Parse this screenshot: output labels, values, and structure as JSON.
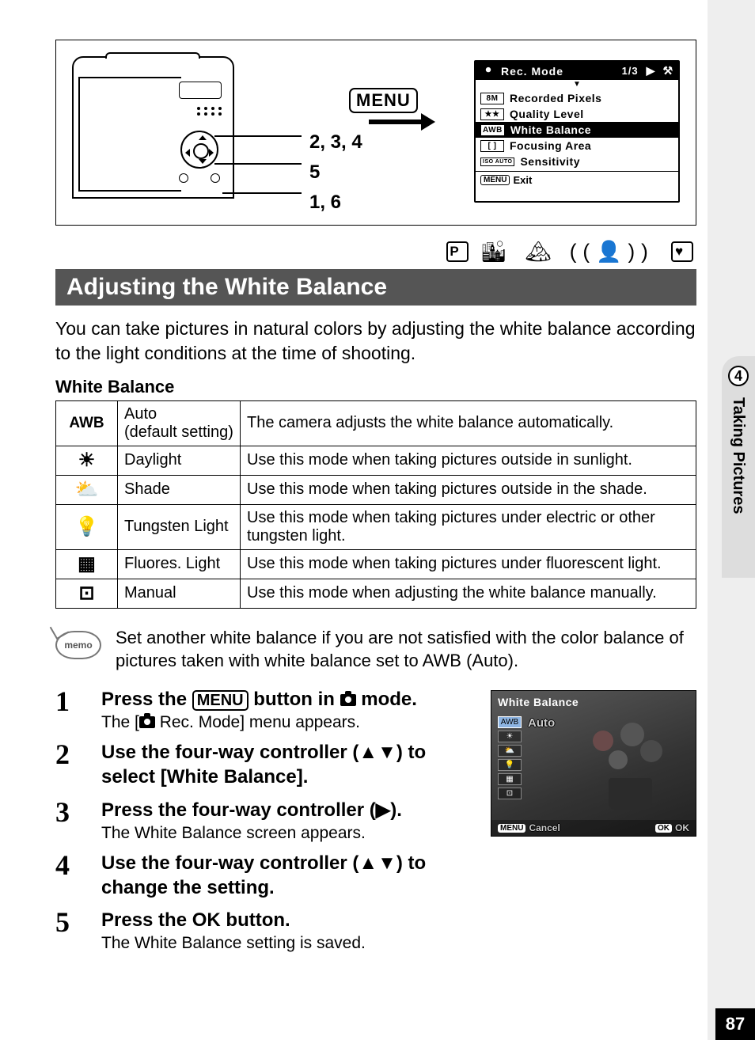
{
  "diagram": {
    "menu_label": "MENU",
    "callouts": [
      "2, 3, 4",
      "5",
      "1, 6"
    ]
  },
  "rec_mode_screen": {
    "title": "Rec. Mode",
    "page_indicator": "1/3",
    "rows": [
      {
        "chip": "8M",
        "label": "Recorded Pixels"
      },
      {
        "chip": "★★",
        "label": "Quality Level"
      },
      {
        "chip": "AWB",
        "label": "White Balance"
      },
      {
        "chip": "[ ]",
        "label": "Focusing Area"
      },
      {
        "chip": "ISO AUTO",
        "label": "Sensitivity"
      }
    ],
    "exit_chip": "MENU",
    "exit_label": "Exit"
  },
  "mode_row": {
    "p": "P"
  },
  "heading": "Adjusting the White Balance",
  "intro": "You can take pictures in natural colors by adjusting the white balance according to the light conditions at the time of shooting.",
  "table_caption": "White Balance",
  "wb_table": [
    {
      "icon": "AWB",
      "name": "Auto\n(default setting)",
      "desc": "The camera adjusts the white balance automatically."
    },
    {
      "icon": "☀",
      "name": "Daylight",
      "desc": "Use this mode when taking pictures outside in sunlight."
    },
    {
      "icon": "⛅",
      "name": "Shade",
      "desc": "Use this mode when taking pictures outside in the shade."
    },
    {
      "icon": "💡",
      "name": "Tungsten Light",
      "desc": "Use this mode when taking pictures under electric or other tungsten light."
    },
    {
      "icon": "▦",
      "name": "Fluores. Light",
      "desc": "Use this mode when taking pictures under fluorescent light."
    },
    {
      "icon": "⊡",
      "name": "Manual",
      "desc": "Use this mode when adjusting the white balance manually."
    }
  ],
  "memo": {
    "label": "memo",
    "text": "Set another white balance if you are not satisfied with the color balance of pictures taken with white balance set to AWB (Auto)."
  },
  "steps": [
    {
      "title_pre": "Press the ",
      "title_menu": "MENU",
      "title_mid": " button in ",
      "title_post": " mode.",
      "desc_pre": "The [",
      "desc_post": " Rec. Mode] menu appears."
    },
    {
      "title": "Use the four-way controller (▲▼) to select [White Balance]."
    },
    {
      "title": "Press the four-way controller (▶).",
      "desc": "The White Balance screen appears."
    },
    {
      "title": "Use the four-way controller (▲▼) to change the setting."
    },
    {
      "title_pre": "Press the ",
      "title_ok": "OK",
      "title_post": " button.",
      "desc": "The White Balance setting is saved."
    }
  ],
  "wb_screen": {
    "title": "White Balance",
    "options": [
      "AWB",
      "☀",
      "⛅",
      "💡",
      "▦",
      "⊡"
    ],
    "selected_label": "Auto",
    "cancel_chip": "MENU",
    "cancel_label": "Cancel",
    "ok_chip": "OK",
    "ok_label": "OK"
  },
  "side_tab": {
    "number": "4",
    "label": "Taking Pictures"
  },
  "page_number": "87"
}
